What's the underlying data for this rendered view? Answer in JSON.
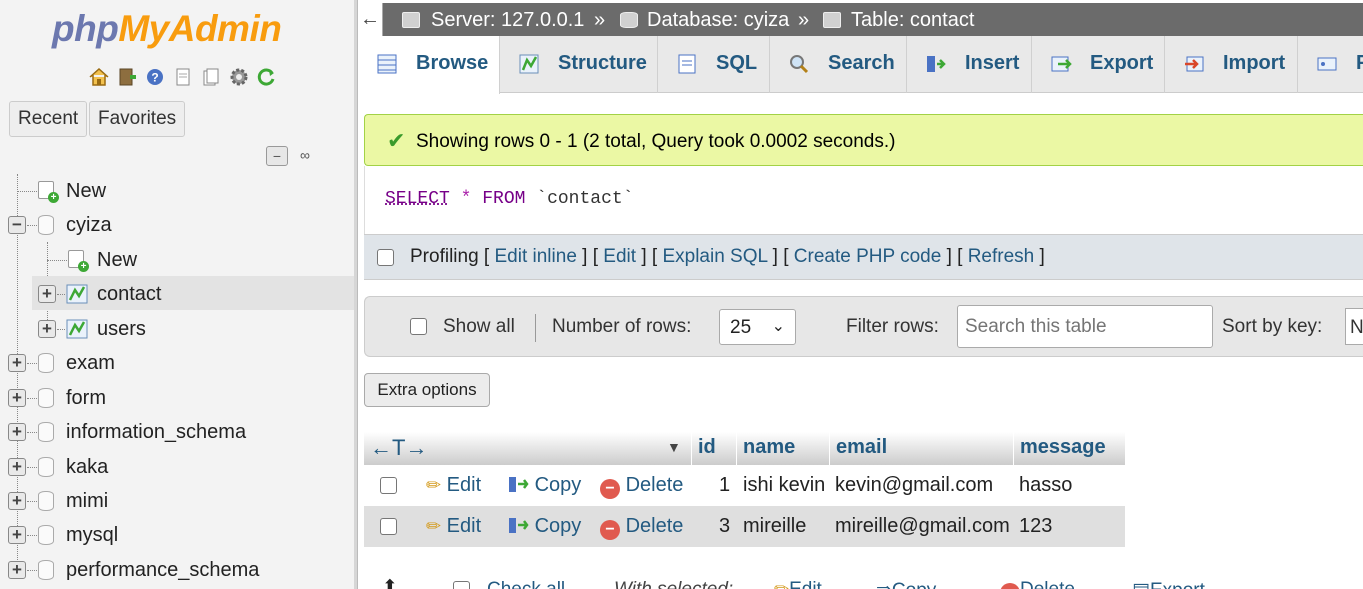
{
  "nav": {
    "logo": {
      "php": "php",
      "my": "My",
      "admin": "Admin"
    },
    "quick_icons": [
      "home-icon",
      "logout-icon",
      "help-icon",
      "docs-icon",
      "settings-icon",
      "reload-icon"
    ],
    "recent_label": "Recent",
    "favorites_label": "Favorites",
    "tree": [
      {
        "label": "New",
        "type": "new",
        "level": 0
      },
      {
        "label": "cyiza",
        "type": "db",
        "level": 0,
        "expanded": true
      },
      {
        "label": "New",
        "type": "new",
        "level": 1
      },
      {
        "label": "contact",
        "type": "table",
        "level": 1,
        "selected": true
      },
      {
        "label": "users",
        "type": "table",
        "level": 1
      },
      {
        "label": "exam",
        "type": "db",
        "level": 0
      },
      {
        "label": "form",
        "type": "db",
        "level": 0
      },
      {
        "label": "information_schema",
        "type": "db",
        "level": 0
      },
      {
        "label": "kaka",
        "type": "db",
        "level": 0
      },
      {
        "label": "mimi",
        "type": "db",
        "level": 0
      },
      {
        "label": "mysql",
        "type": "db",
        "level": 0
      },
      {
        "label": "performance_schema",
        "type": "db",
        "level": 0
      }
    ]
  },
  "breadcrumb": {
    "server": "Server: 127.0.0.1",
    "database": "Database: cyiza",
    "table": "Table: contact",
    "separator": "»"
  },
  "tabs": [
    {
      "label": "Browse",
      "icon": "browse-icon",
      "active": true
    },
    {
      "label": "Structure",
      "icon": "structure-icon"
    },
    {
      "label": "SQL",
      "icon": "sql-icon"
    },
    {
      "label": "Search",
      "icon": "search-icon"
    },
    {
      "label": "Insert",
      "icon": "insert-icon"
    },
    {
      "label": "Export",
      "icon": "export-icon"
    },
    {
      "label": "Import",
      "icon": "import-icon"
    },
    {
      "label": "P",
      "icon": "privileges-icon"
    }
  ],
  "success_message": "Showing rows 0 - 1 (2 total, Query took 0.0002 seconds.)",
  "sql": {
    "select": "SELECT",
    "star": "*",
    "from": "FROM",
    "table": "`contact`"
  },
  "profiling": {
    "label": "Profiling",
    "links": [
      "Edit inline",
      "Edit",
      "Explain SQL",
      "Create PHP code",
      "Refresh"
    ]
  },
  "filter": {
    "show_all": "Show all",
    "num_rows_label": "Number of rows:",
    "num_rows_value": "25",
    "filter_label": "Filter rows:",
    "search_placeholder": "Search this table",
    "sort_label": "Sort by key:",
    "sort_value": "N"
  },
  "extra_options": "Extra options",
  "table": {
    "columns": [
      "id",
      "name",
      "email",
      "message"
    ],
    "actions": {
      "edit": "Edit",
      "copy": "Copy",
      "delete": "Delete"
    },
    "rows": [
      {
        "id": "1",
        "name": "ishi kevin",
        "email": "kevin@gmail.com",
        "message": "hasso"
      },
      {
        "id": "3",
        "name": "mireille",
        "email": "mireille@gmail.com",
        "message": "123"
      }
    ]
  },
  "bottom": {
    "check_all": "Check all",
    "with_selected": "With selected:",
    "edit": "Edit",
    "copy": "Copy",
    "delete": "Delete",
    "export": "Export"
  },
  "colors": {
    "link": "#235a81",
    "success_bg": "#ebf8a4",
    "topbar": "#6b6b6b",
    "logo_php": "#6c78af",
    "logo_admin": "#f89c0e"
  }
}
